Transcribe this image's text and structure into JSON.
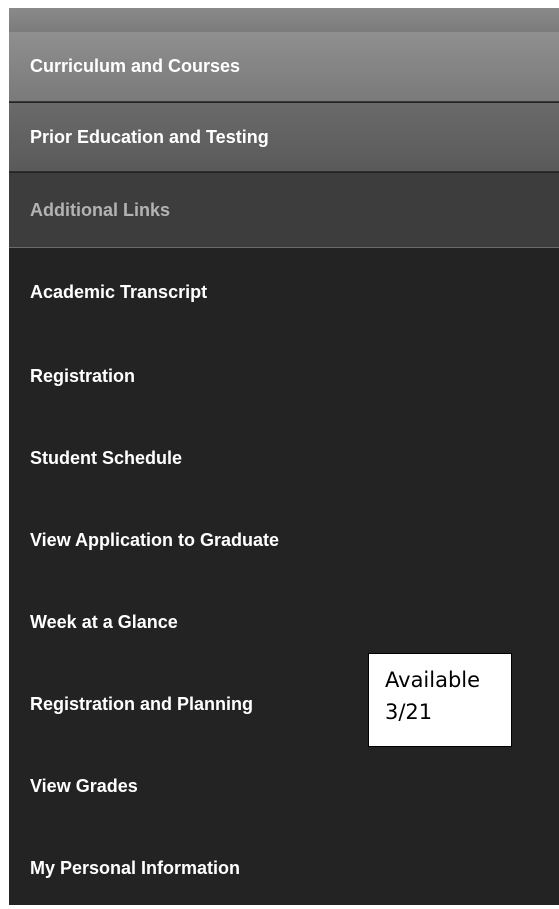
{
  "sections": [
    {
      "label": "Curriculum and Courses"
    },
    {
      "label": "Prior Education and Testing"
    },
    {
      "label": "Additional Links"
    }
  ],
  "links": [
    {
      "label": "Academic Transcript"
    },
    {
      "label": "Registration"
    },
    {
      "label": "Student Schedule"
    },
    {
      "label": "View Application to Graduate"
    },
    {
      "label": "Week at a Glance"
    },
    {
      "label": "Registration and Planning"
    },
    {
      "label": "View Grades"
    },
    {
      "label": "My Personal Information"
    }
  ],
  "annotation": {
    "line1": "Available",
    "line2": "3/21"
  },
  "colors": {
    "panel_bg": "#232323",
    "section_active": "#8a8a8a",
    "section_secondary": "#626262",
    "section_header": "#3d3d3d",
    "link_text": "#ffffff"
  }
}
